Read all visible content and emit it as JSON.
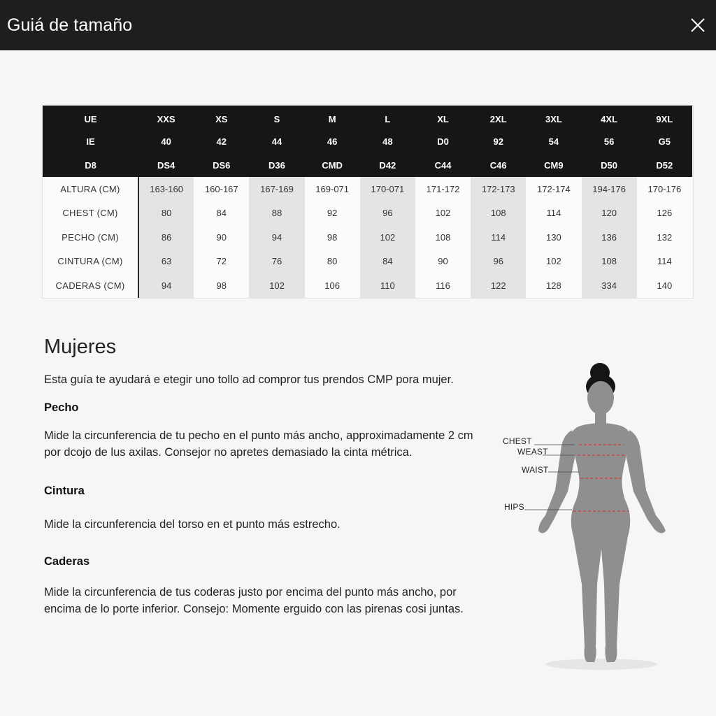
{
  "header": {
    "title": "Guiá de tamaño",
    "close_icon": "close-icon"
  },
  "size_table": {
    "header_rows": [
      {
        "label": "UE",
        "values": [
          "XXS",
          "XS",
          "S",
          "M",
          "L",
          "XL",
          "2XL",
          "3XL",
          "4XL",
          "9XL"
        ]
      },
      {
        "label": "IE",
        "values": [
          "40",
          "42",
          "44",
          "46",
          "48",
          "D0",
          "92",
          "54",
          "56",
          "G5"
        ]
      },
      {
        "label": "D8",
        "values": [
          "DS4",
          "DS6",
          "D36",
          "CMD",
          "D42",
          "C44",
          "C46",
          "CM9",
          "D50",
          "D52"
        ]
      }
    ],
    "body_rows": [
      {
        "label": "ALTURA (CM)",
        "values": [
          "163-160",
          "160-167",
          "167-169",
          "169-071",
          "170-071",
          "171-172",
          "172-173",
          "172-174",
          "194-176",
          "170-176"
        ]
      },
      {
        "label": "CHEST (CM)",
        "values": [
          "80",
          "84",
          "88",
          "92",
          "96",
          "102",
          "108",
          "114",
          "120",
          "126"
        ]
      },
      {
        "label": "PECHO (CM)",
        "values": [
          "86",
          "90",
          "94",
          "98",
          "102",
          "108",
          "114",
          "130",
          "136",
          "132"
        ]
      },
      {
        "label": "CINTURA (CM)",
        "values": [
          "63",
          "72",
          "76",
          "80",
          "84",
          "90",
          "96",
          "102",
          "108",
          "114"
        ]
      },
      {
        "label": "CADERAS (CM)",
        "values": [
          "94",
          "98",
          "102",
          "106",
          "110",
          "116",
          "122",
          "128",
          "334",
          "140"
        ]
      }
    ]
  },
  "guide": {
    "title": "Mujeres",
    "intro": "Esta guía te ayudará e etegir uno tollo ad compror tus prendos CMP pora mujer.",
    "sections": [
      {
        "heading": "Pecho",
        "text": "Mide la circunferencia de tu pecho en el punto más ancho, approximadamente 2 cm por dcojo de lus axilas. Consejor no apretes demasiado la cinta métrica."
      },
      {
        "heading": "Cintura",
        "text": "Mide la circunferencia del torso en et punto más estrecho."
      },
      {
        "heading": "Caderas",
        "text": "Mide la circunferencia de tus coderas justo por encima del punto más ancho, por encima de lo porte inferior. Consejo: Momente erguido con las pirenas cosi juntas."
      }
    ]
  },
  "figure": {
    "labels": {
      "chest": "CHEST",
      "waist_upper": "WEAST",
      "waist": "WAIST",
      "hips": "HIPS"
    },
    "icon": "body-silhouette-icon",
    "colors": {
      "body": "#8f8f8f",
      "measure_line": "#d43b3b"
    }
  },
  "colors": {
    "header_bg": "#1e1e1e",
    "table_head_bg": "#161616",
    "shade": "#e4e4e4"
  }
}
